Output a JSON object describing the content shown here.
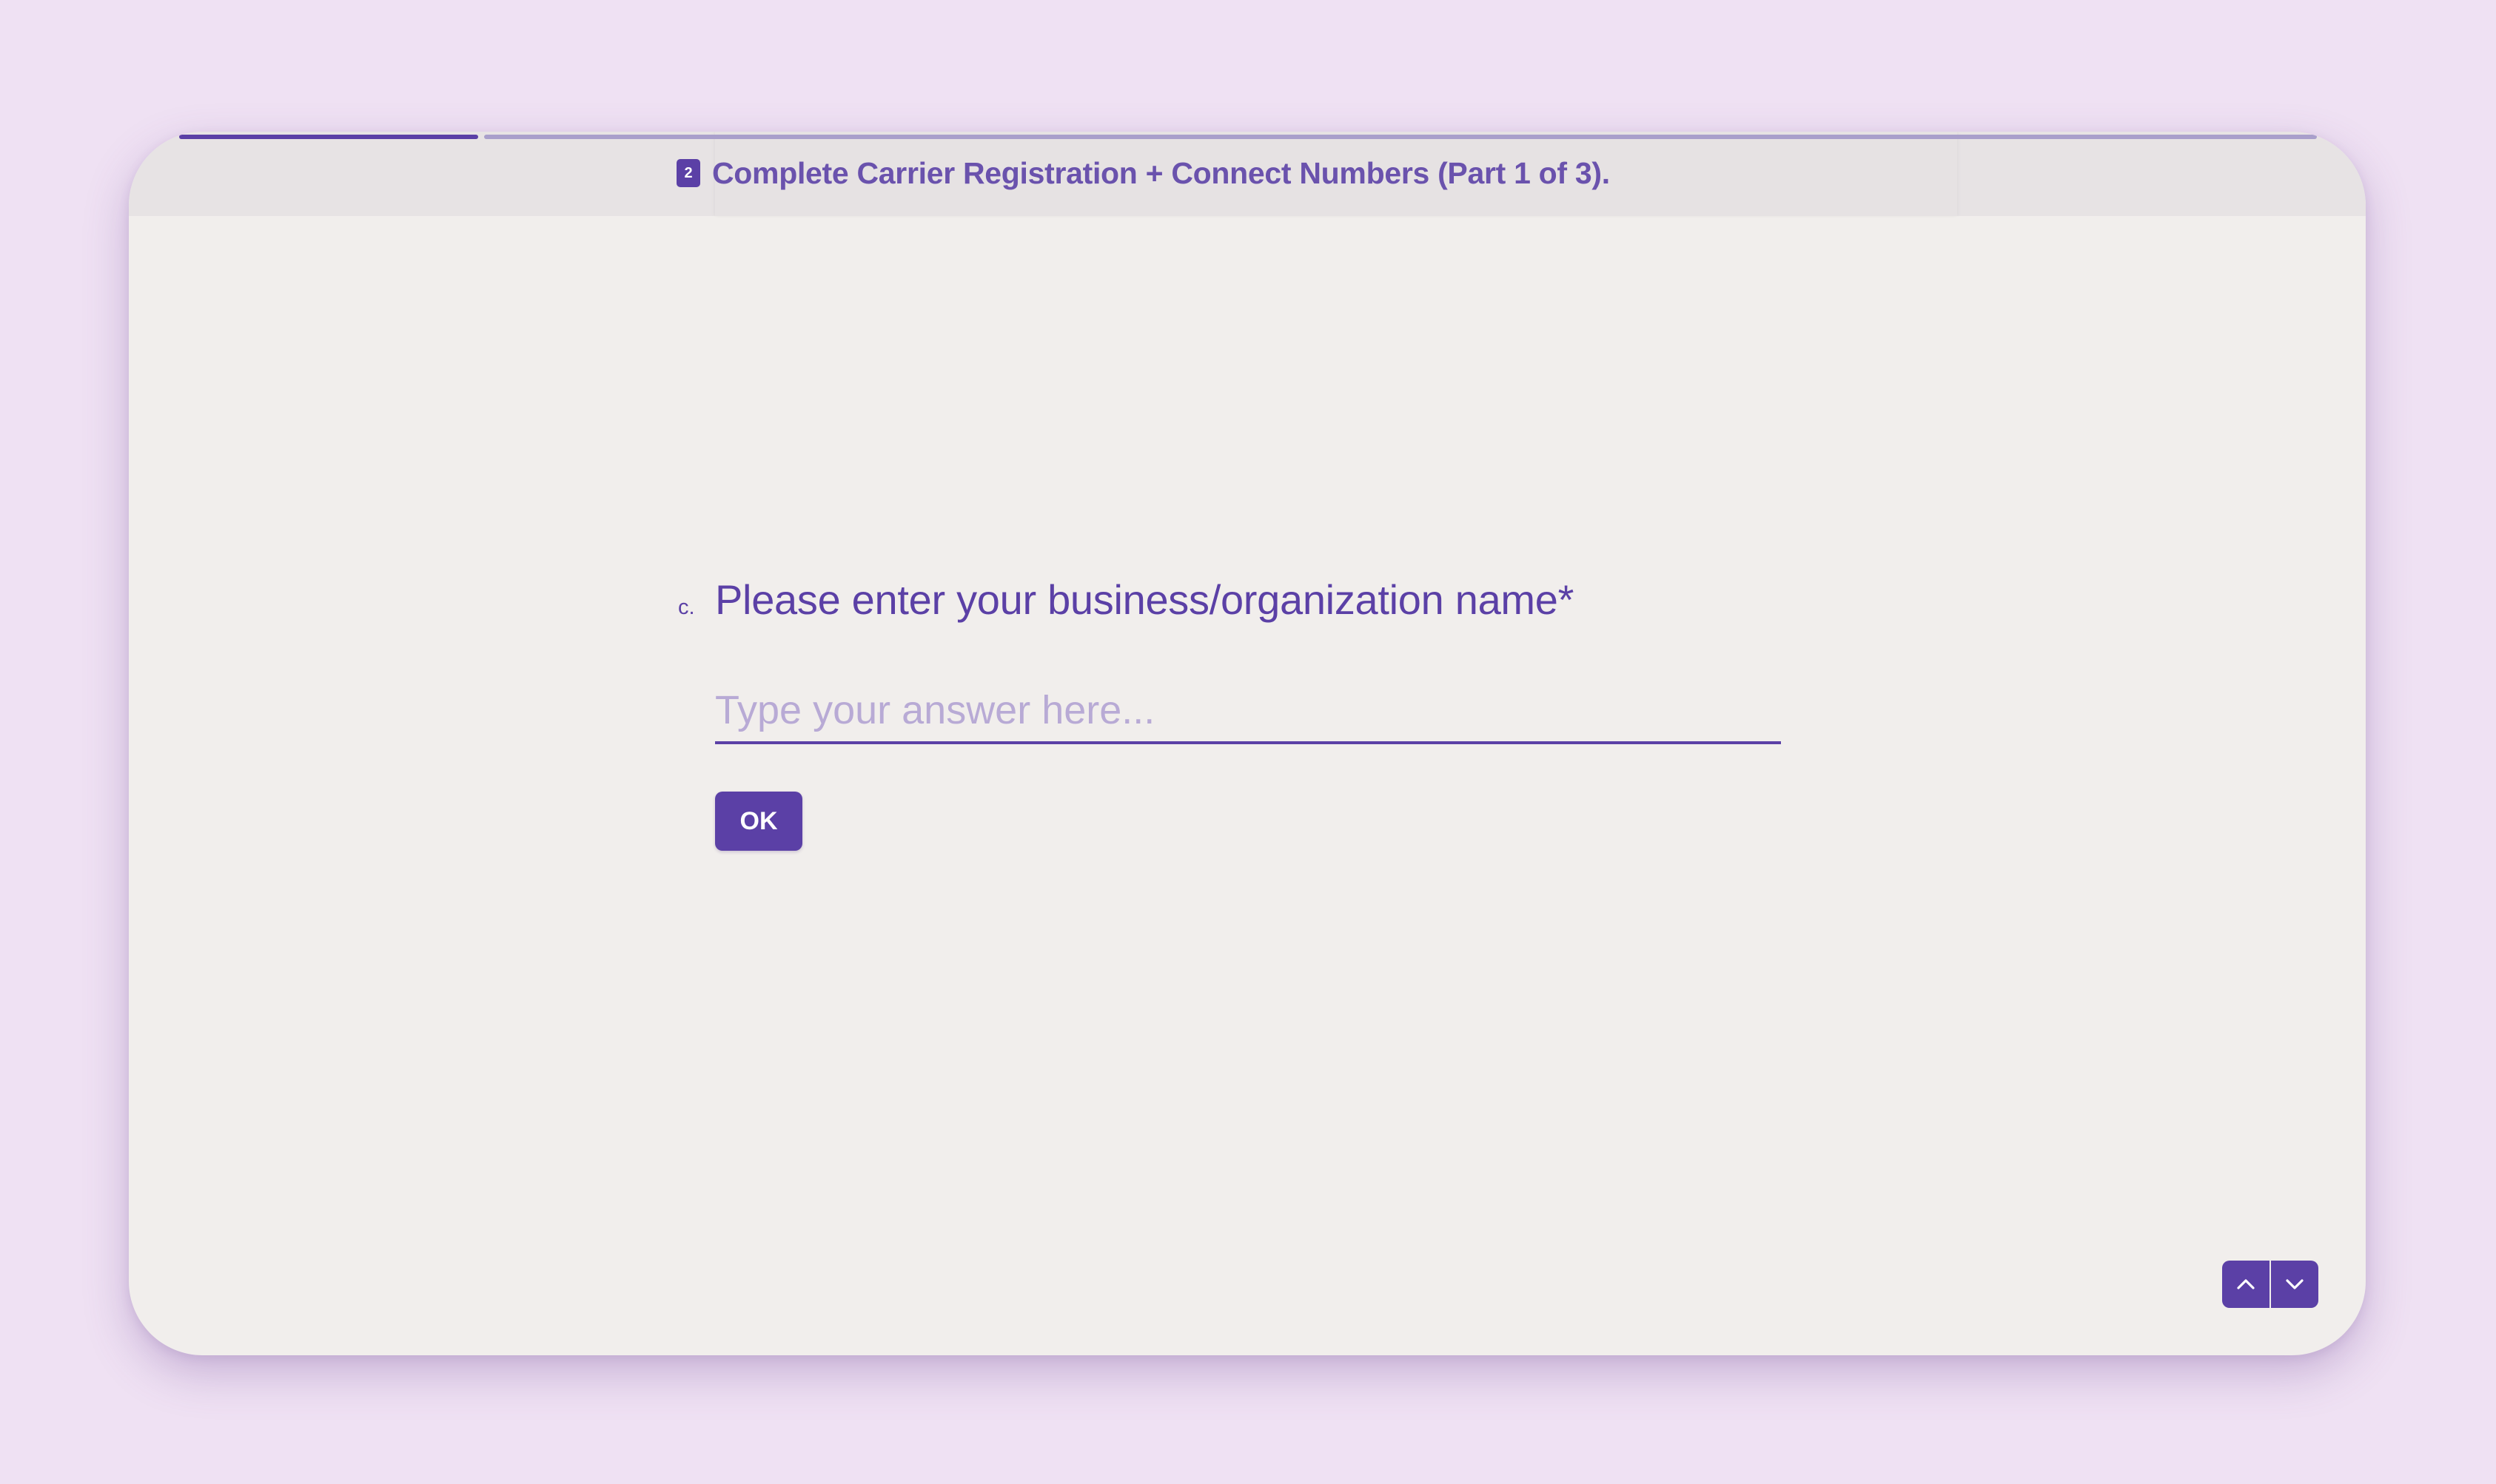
{
  "colors": {
    "page_background": "#efe1f3",
    "card_background": "#f1eeec",
    "accent": "#5b40a6",
    "progress_empty": "#a99fcb",
    "placeholder": "#b8aad5"
  },
  "progress": {
    "segments": [
      {
        "filled": true
      },
      {
        "filled": false
      }
    ],
    "fraction_complete": 0.14
  },
  "header": {
    "section_number": "2",
    "section_title": "Complete Carrier Registration + Connect Numbers (Part 1 of 3)."
  },
  "question": {
    "label": "c.",
    "text": "Please enter your business/organization name",
    "required_mark": "*"
  },
  "answer": {
    "placeholder": "Type your answer here...",
    "value": ""
  },
  "ok_button": {
    "label": "OK"
  },
  "navigation": {
    "up_icon": "chevron-up-icon",
    "down_icon": "chevron-down-icon"
  }
}
